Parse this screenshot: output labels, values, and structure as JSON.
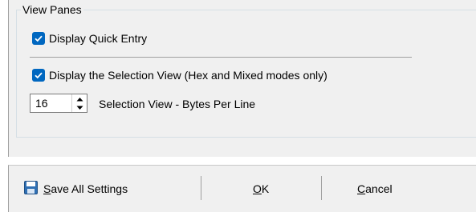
{
  "group": {
    "legend": "View Panes"
  },
  "options": {
    "quick_entry": {
      "label": "Display Quick Entry",
      "checked": true
    },
    "selection_view": {
      "label": "Display the Selection View (Hex and Mixed modes only)",
      "checked": true
    }
  },
  "bytes_per_line": {
    "value": "16",
    "label": "Selection View - Bytes Per Line"
  },
  "buttons": {
    "save": {
      "mnemonic": "S",
      "rest": "ave All Settings"
    },
    "ok": {
      "mnemonic": "O",
      "rest": "K"
    },
    "cancel": {
      "mnemonic": "C",
      "rest": "ancel"
    }
  },
  "colors": {
    "accent": "#0067c0",
    "panel": "#f0f0f0"
  },
  "icons": {
    "checkbox": "checkmark-icon",
    "save": "floppy-disk-icon"
  }
}
